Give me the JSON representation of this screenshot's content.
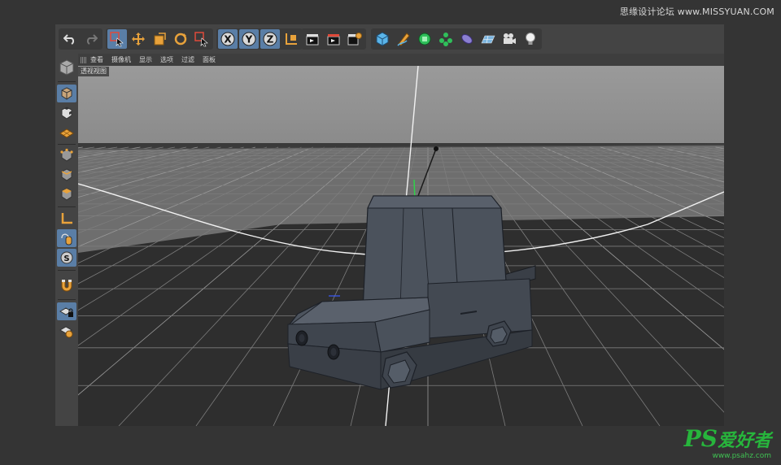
{
  "watermark_top": "思缘设计论坛 www.MISSYUAN.COM",
  "viewport_menu": [
    "查看",
    "摄像机",
    "显示",
    "选项",
    "过滤",
    "面板"
  ],
  "viewport_label": "透视视图",
  "axis_buttons": [
    "X",
    "Y",
    "Z"
  ],
  "ps_logo": {
    "mark": "PS",
    "text": "爱好者",
    "url": "www.psahz.com"
  },
  "colors": {
    "active": "#5a7ea6",
    "accent_orange": "#e8a23b",
    "logo_green": "#27b53c"
  }
}
